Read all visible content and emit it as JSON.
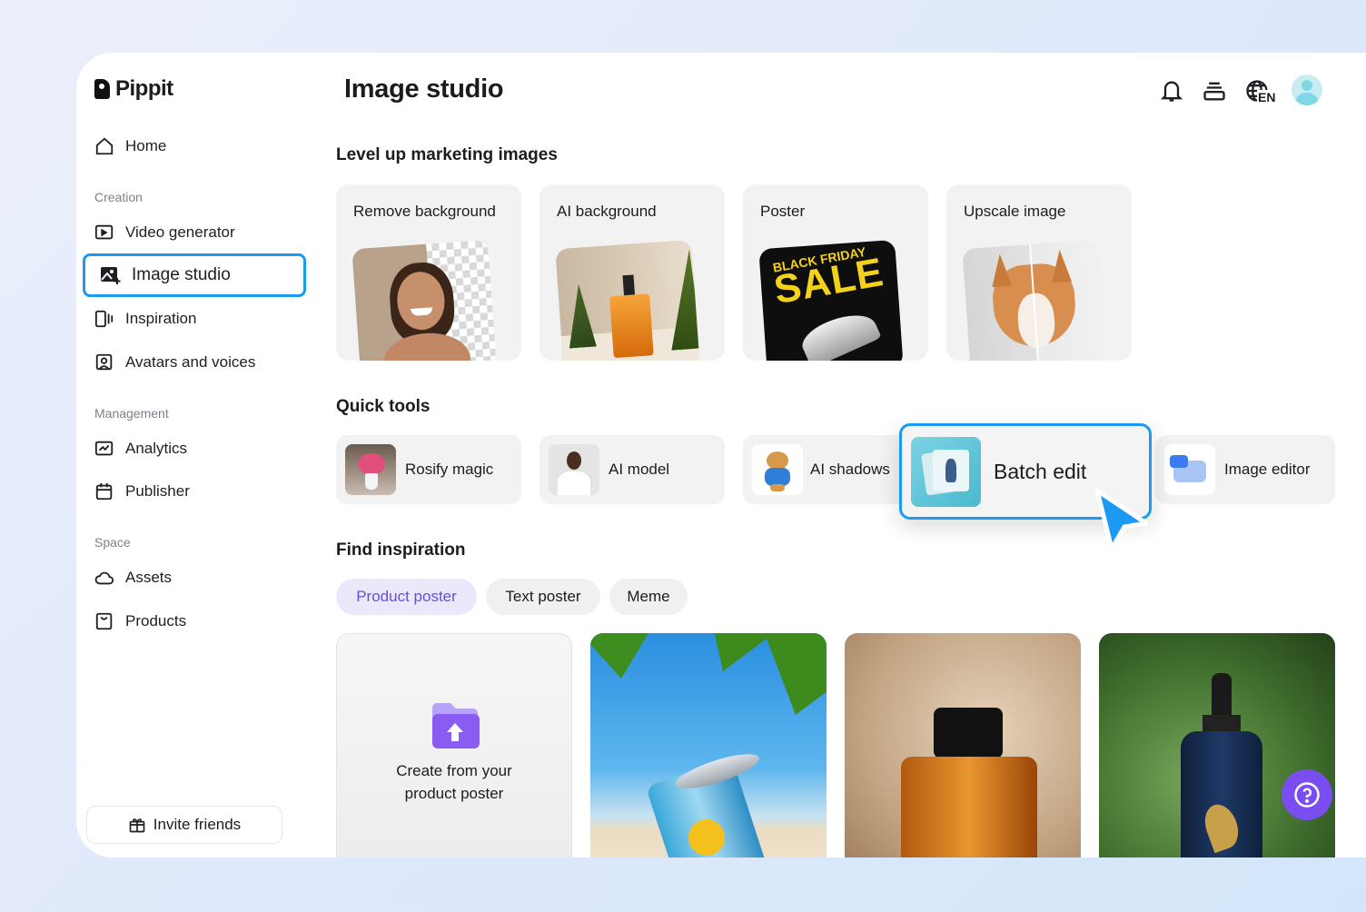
{
  "app": {
    "brand": "Pippit"
  },
  "sidebar": {
    "home": "Home",
    "section_creation": "Creation",
    "video_generator": "Video generator",
    "image_studio": "Image studio",
    "inspiration": "Inspiration",
    "avatars": "Avatars and voices",
    "section_management": "Management",
    "analytics": "Analytics",
    "publisher": "Publisher",
    "section_space": "Space",
    "assets": "Assets",
    "products": "Products",
    "invite": "Invite friends"
  },
  "header": {
    "title": "Image studio",
    "language": "EN"
  },
  "marketing": {
    "heading": "Level up marketing images",
    "cards": [
      "Remove background",
      "AI background",
      "Poster",
      "Upscale image"
    ],
    "poster_text_top": "BLACK FRIDAY",
    "poster_text_main": "SALE"
  },
  "quick_tools": {
    "heading": "Quick tools",
    "items": [
      "Rosify magic",
      "AI model",
      "AI shadows",
      "Batch edit",
      "Image editor"
    ]
  },
  "inspiration": {
    "heading": "Find inspiration",
    "tabs": [
      "Product poster",
      "Text poster",
      "Meme"
    ],
    "create_line1": "Create from your",
    "create_line2": "product poster"
  },
  "colors": {
    "accent": "#1a9af2",
    "purple": "#7a4df0",
    "tab_active_text": "#6a4de0"
  }
}
